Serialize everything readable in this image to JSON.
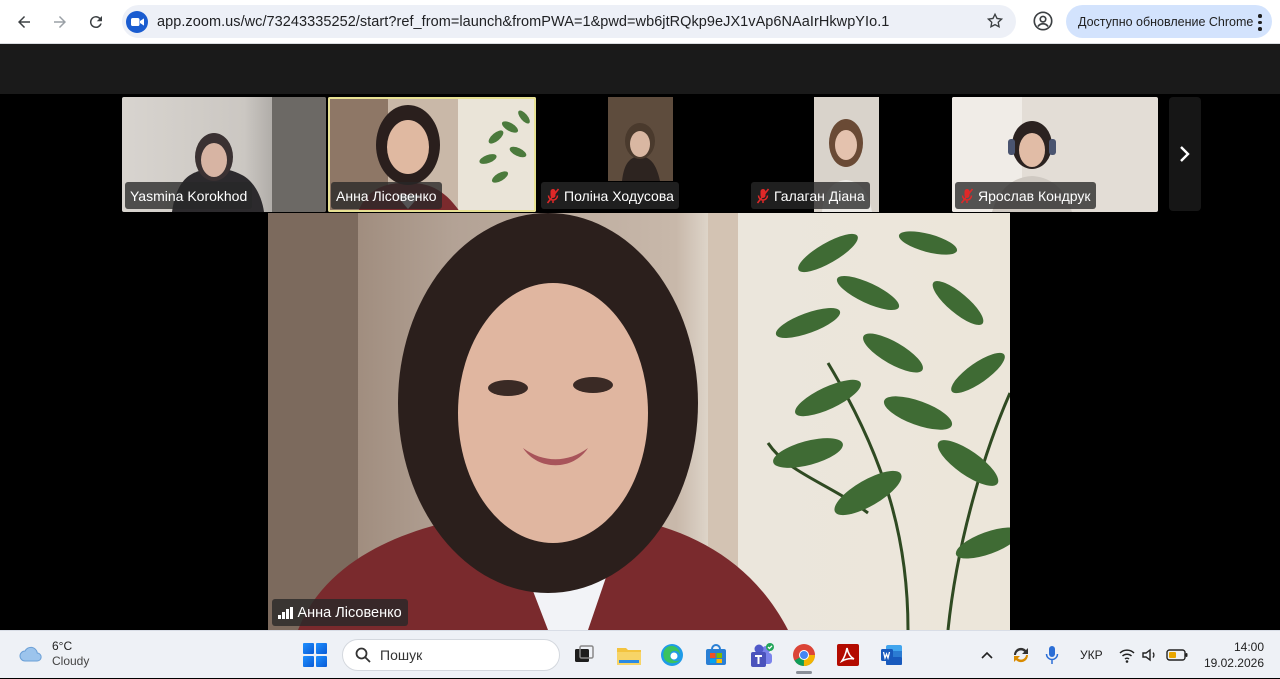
{
  "browser": {
    "url": "app.zoom.us/wc/73243335252/start?ref_from=launch&fromPWA=1&pwd=wb6jtRQkp9eJX1vAp6NAaIrHkwpYIo.1",
    "update_label": "Доступно обновление Chrome"
  },
  "meeting": {
    "gallery": [
      {
        "name": "Yasmina Korokhod",
        "muted": false
      },
      {
        "name": "Анна Лісовенко",
        "muted": false,
        "active": true
      },
      {
        "name": "Поліна Ходусова",
        "muted": true
      },
      {
        "name": "Галаган Діана",
        "muted": true
      },
      {
        "name": "Ярослав Кондрук",
        "muted": true
      }
    ],
    "speaker_name": "Анна Лісовенко"
  },
  "taskbar": {
    "weather_temp": "6°C",
    "weather_desc": "Cloudy",
    "search_placeholder": "Пошук",
    "language": "УКР",
    "time": "14:00",
    "date": "19.02.2026"
  },
  "colors": {
    "zoom_blue": "#0b5cff",
    "active_speaker_border": "#e7e193",
    "muted_red": "#e02828"
  }
}
